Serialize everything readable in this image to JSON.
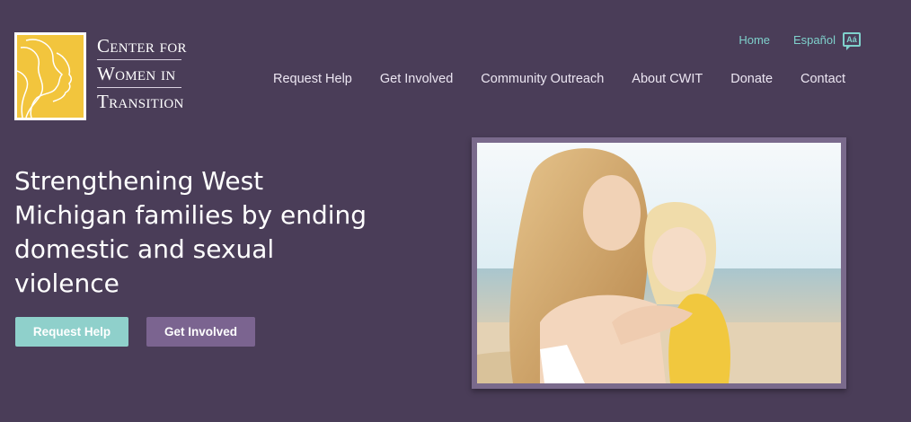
{
  "logo": {
    "line1": "Center for",
    "line2": "Women in",
    "line3": "Transition"
  },
  "utility_nav": {
    "home": "Home",
    "espanol": "Español",
    "lang_icon": "translate-icon",
    "lang_icon_glyph": "Aá"
  },
  "main_nav": [
    "Request Help",
    "Get Involved",
    "Community Outreach",
    "About CWIT",
    "Donate",
    "Contact"
  ],
  "hero": {
    "headline": "Strengthening West Michigan families by ending domestic and sexual violence",
    "primary_button": "Request Help",
    "secondary_button": "Get Involved"
  },
  "colors": {
    "background": "#4a3d58",
    "accent_teal": "#8fd0cb",
    "accent_purple": "#7b6490",
    "logo_yellow": "#f2c53d"
  }
}
